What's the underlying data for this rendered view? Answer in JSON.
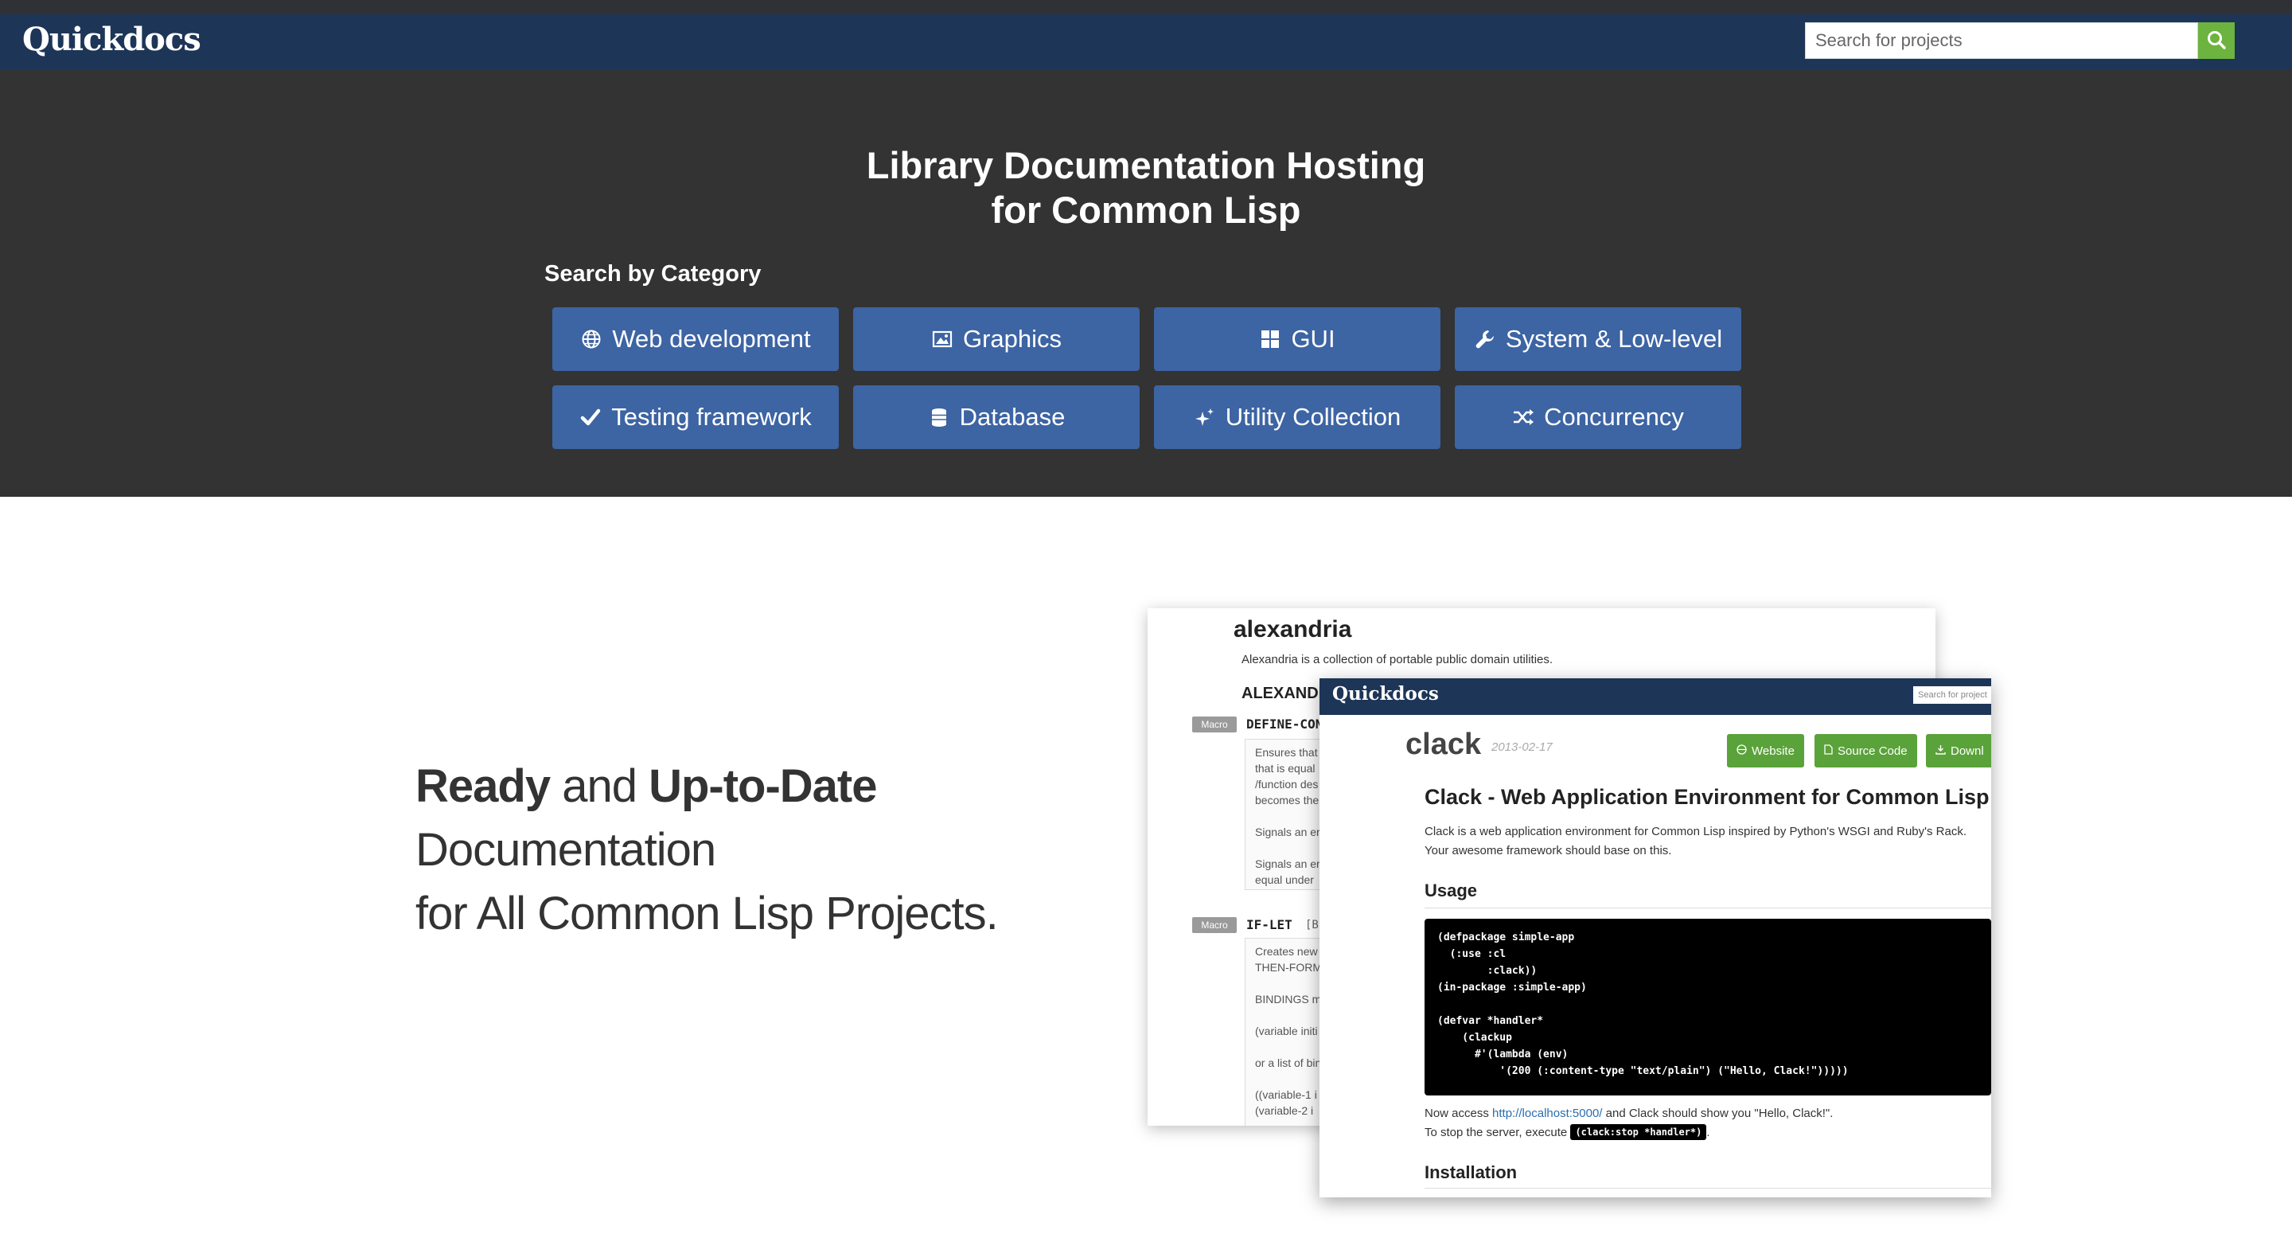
{
  "navbar": {
    "brand": "Quickdocs",
    "search_placeholder": "Search for projects"
  },
  "hero": {
    "title_line1": "Library Documentation Hosting",
    "title_line2": "for Common Lisp",
    "category_heading": "Search by Category",
    "categories": [
      {
        "label": "Web development",
        "icon": "globe-icon"
      },
      {
        "label": "Graphics",
        "icon": "image-icon"
      },
      {
        "label": "GUI",
        "icon": "grid-icon"
      },
      {
        "label": "System & Low-level",
        "icon": "wrench-icon"
      },
      {
        "label": "Testing framework",
        "icon": "check-icon"
      },
      {
        "label": "Database",
        "icon": "database-icon"
      },
      {
        "label": "Utility Collection",
        "icon": "sparkle-icon"
      },
      {
        "label": "Concurrency",
        "icon": "shuffle-icon"
      }
    ]
  },
  "feature": {
    "tagline_bold1": "Ready",
    "tagline_and": " and ",
    "tagline_bold2": "Up-to-Date",
    "tagline_line2": "Documentation",
    "tagline_line3": "for All Common Lisp Projects."
  },
  "shot_alexandria": {
    "title": "alexandria",
    "description": "Alexandria is a collection of portable public domain utilities.",
    "package_heading": "ALEXANDRIA",
    "macro_tag": "Macro",
    "item1_name": "DEFINE-CONSTANT",
    "item1_lines": [
      "Ensures that",
      "that is equal",
      "/function des",
      "becomes the",
      "Signals an er",
      "Signals an er",
      "equal under"
    ],
    "item2_name": "IF-LET",
    "item2_args": "[B",
    "item2_lines": [
      "Creates new",
      "THEN-FORM",
      "BINDINGS m",
      "(variable initi",
      "or a list of bin",
      "((variable-1 i",
      " (variable-2 i"
    ]
  },
  "shot_clack": {
    "brand": "Quickdocs",
    "search_placeholder": "Search for project",
    "name": "clack",
    "date": "2013-02-17",
    "btn_website": "Website",
    "btn_source": "Source Code",
    "btn_download": "Downl",
    "heading": "Clack - Web Application Environment for Common Lisp",
    "desc1": "Clack is a web application environment for Common Lisp inspired by Python's WSGI and Ruby's Rack.",
    "desc2": "Your awesome framework should base on this.",
    "usage_heading": "Usage",
    "code": [
      "(defpackage simple-app",
      "  (:use :cl",
      "        :clack))",
      "(in-package :simple-app)",
      "",
      "(defvar *handler*",
      "    (clackup",
      "      #'(lambda (env)",
      "          '(200 (:content-type \"text/plain\") (\"Hello, Clack!\")))))"
    ],
    "access_pre": "Now access ",
    "access_link": "http://localhost:5000/",
    "access_post": " and Clack should show you \"Hello, Clack!\".",
    "stop_pre": "To stop the server, execute ",
    "stop_code": "(clack:stop *handler*)",
    "stop_post": ".",
    "install_heading": "Installation"
  }
}
